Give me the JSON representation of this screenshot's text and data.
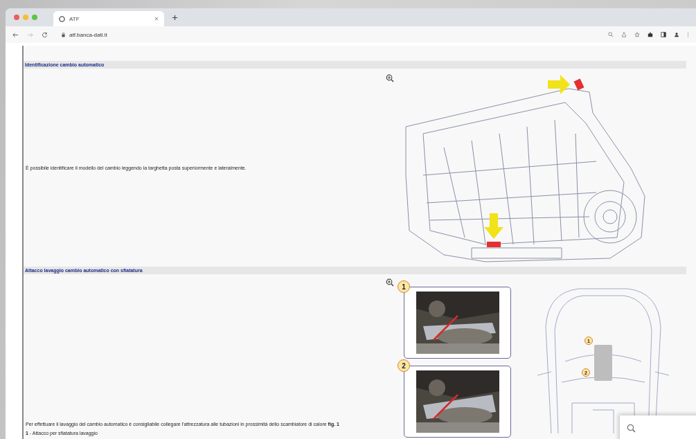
{
  "browser": {
    "tab": {
      "title": "ATF"
    },
    "url": "atf.banca-dati.it"
  },
  "sections": [
    {
      "kind": "diagram",
      "heading": "Identificazione cambio automatico",
      "paragraphs": [
        "È possibile identificare il modello del cambio leggendo la targhetta posta superiormente e lateralmente."
      ]
    },
    {
      "kind": "photos",
      "heading": "Attacco lavaggio cambio automatico con sfiatatura",
      "paragraphs": [
        "Per effettuare il lavaggio del cambio automatico è consigliabile collegare l'attrezzatura alle tubazioni in prossimità dello scambiatore di calore **fig. 1**",
        "**1** - Attacco per sfiatatura lavaggio"
      ],
      "photo_badges": [
        "1",
        "2"
      ],
      "car_labels": [
        "1",
        "2"
      ]
    }
  ]
}
